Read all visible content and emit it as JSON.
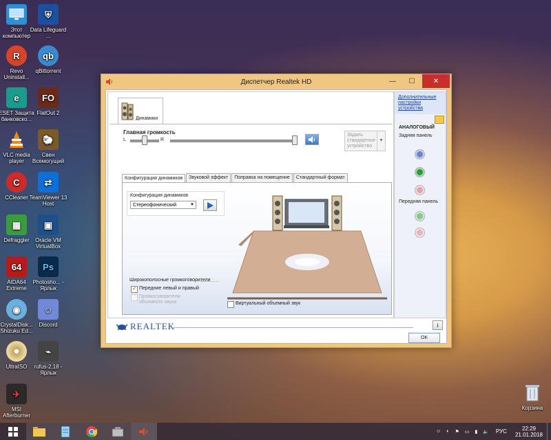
{
  "desktop": {
    "icons": [
      {
        "label": "Этот компьютер"
      },
      {
        "label": "Data Lifeguard ..."
      },
      {
        "label": "Revo Uninstall..."
      },
      {
        "label": "qBittorrent"
      },
      {
        "label": "ESET Защита банковско..."
      },
      {
        "label": "FlatOut 2"
      },
      {
        "label": "VLC media player"
      },
      {
        "label": "Свен Всемогущий"
      },
      {
        "label": "CCleaner"
      },
      {
        "label": "TeamViewer 13 Host"
      },
      {
        "label": "Defraggler"
      },
      {
        "label": "Oracle VM VirtualBox"
      },
      {
        "label": "AIDA64 Extreme"
      },
      {
        "label": "Photosho... - Ярлык"
      },
      {
        "label": "CrystalDisk... Shizuku Ed..."
      },
      {
        "label": "Discord"
      },
      {
        "label": "UltraISO"
      },
      {
        "label": "rufus-2.18 - Ярлык"
      },
      {
        "label": "MSI Afterburner"
      },
      {
        "label": "Корзина"
      }
    ]
  },
  "window": {
    "title": "Диспетчер Realtek HD",
    "device_tab": "Динамики",
    "main_volume": {
      "label": "Главная громкость",
      "left": "L",
      "right": "R",
      "balance": 0.5,
      "level": 1.0
    },
    "set_default": "Задать стандартное устройство",
    "tabs": [
      "Конфигурация динамиков",
      "Звуковой эффект",
      "Поправка на помещение",
      "Стандартный формат"
    ],
    "config": {
      "label": "Конфигурация динамиков",
      "selected": "Стереофонический"
    },
    "fullrange": {
      "title": "Широкополосные громкоговорители",
      "front": "Передние левый и правый",
      "front_checked": true,
      "surround": "Громкоговорители объемного звука",
      "surround_checked": false
    },
    "virtual_surround": "Виртуальный объемный звук",
    "sidebar": {
      "link": "Дополнительные настройки устройства",
      "analog": "АНАЛОГОВЫЙ",
      "rear": "Задняя панель",
      "front": "Передняя панель"
    },
    "brand": "REALTEK",
    "ok": "OK"
  },
  "taskbar": {
    "lang": "РУС",
    "time": "22:29",
    "date": "21.01.2018"
  },
  "colors": {
    "jack_blue": "#6c87c9",
    "jack_green": "#2e9a3c",
    "jack_pink": "#e0a6b0",
    "jack_green_light": "#8ac48e",
    "jack_pink_light": "#e3b6bd",
    "window_frame": "#f0c780",
    "titlebar_close": "#c7302a"
  }
}
